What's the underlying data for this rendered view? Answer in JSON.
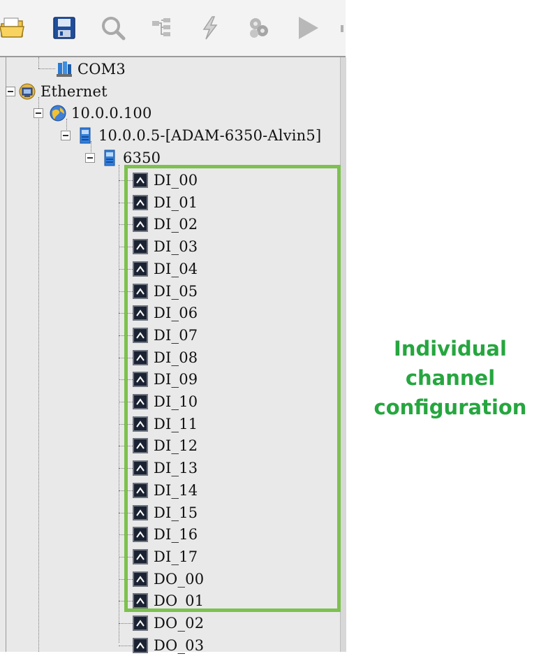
{
  "toolbar": {
    "buttons": [
      {
        "icon": "open-folder-icon"
      },
      {
        "icon": "save-icon"
      },
      {
        "icon": "search-icon"
      },
      {
        "icon": "network-tree-icon"
      },
      {
        "icon": "lightning-icon"
      },
      {
        "icon": "gear-cluster-icon"
      },
      {
        "icon": "play-icon"
      }
    ]
  },
  "tree": {
    "com3": "COM3",
    "ethernet": "Ethernet",
    "host": "10.0.0.100",
    "device": "10.0.0.5-[ADAM-6350-Alvin5]",
    "module": "6350",
    "channels": [
      "DI_00",
      "DI_01",
      "DI_02",
      "DI_03",
      "DI_04",
      "DI_05",
      "DI_06",
      "DI_07",
      "DI_08",
      "DI_09",
      "DI_10",
      "DI_11",
      "DI_12",
      "DI_13",
      "DI_14",
      "DI_15",
      "DI_16",
      "DI_17",
      "DO_00",
      "DO_01",
      "DO_02",
      "DO_03"
    ]
  },
  "annotation": {
    "line1": "Individual channel",
    "line2": "configuration"
  },
  "colors": {
    "highlight": "#7dc14e",
    "annotation_text": "#26a63f"
  }
}
